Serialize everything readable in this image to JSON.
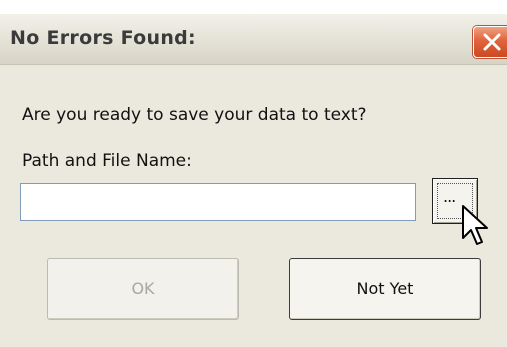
{
  "dialog": {
    "title": "No Errors Found:",
    "question": "Are you ready to save your data to text?",
    "path_label": "Path and File Name:",
    "path_value": "",
    "browse_label": "...",
    "ok_label": "OK",
    "not_yet_label": "Not Yet"
  },
  "icons": {
    "close": "close-icon",
    "cursor": "mouse-pointer-icon"
  },
  "colors": {
    "titlebar": "#e4e2d6",
    "body": "#ebe9de",
    "close_button": "#e0643d",
    "disabled_text": "#a9a7a0"
  }
}
